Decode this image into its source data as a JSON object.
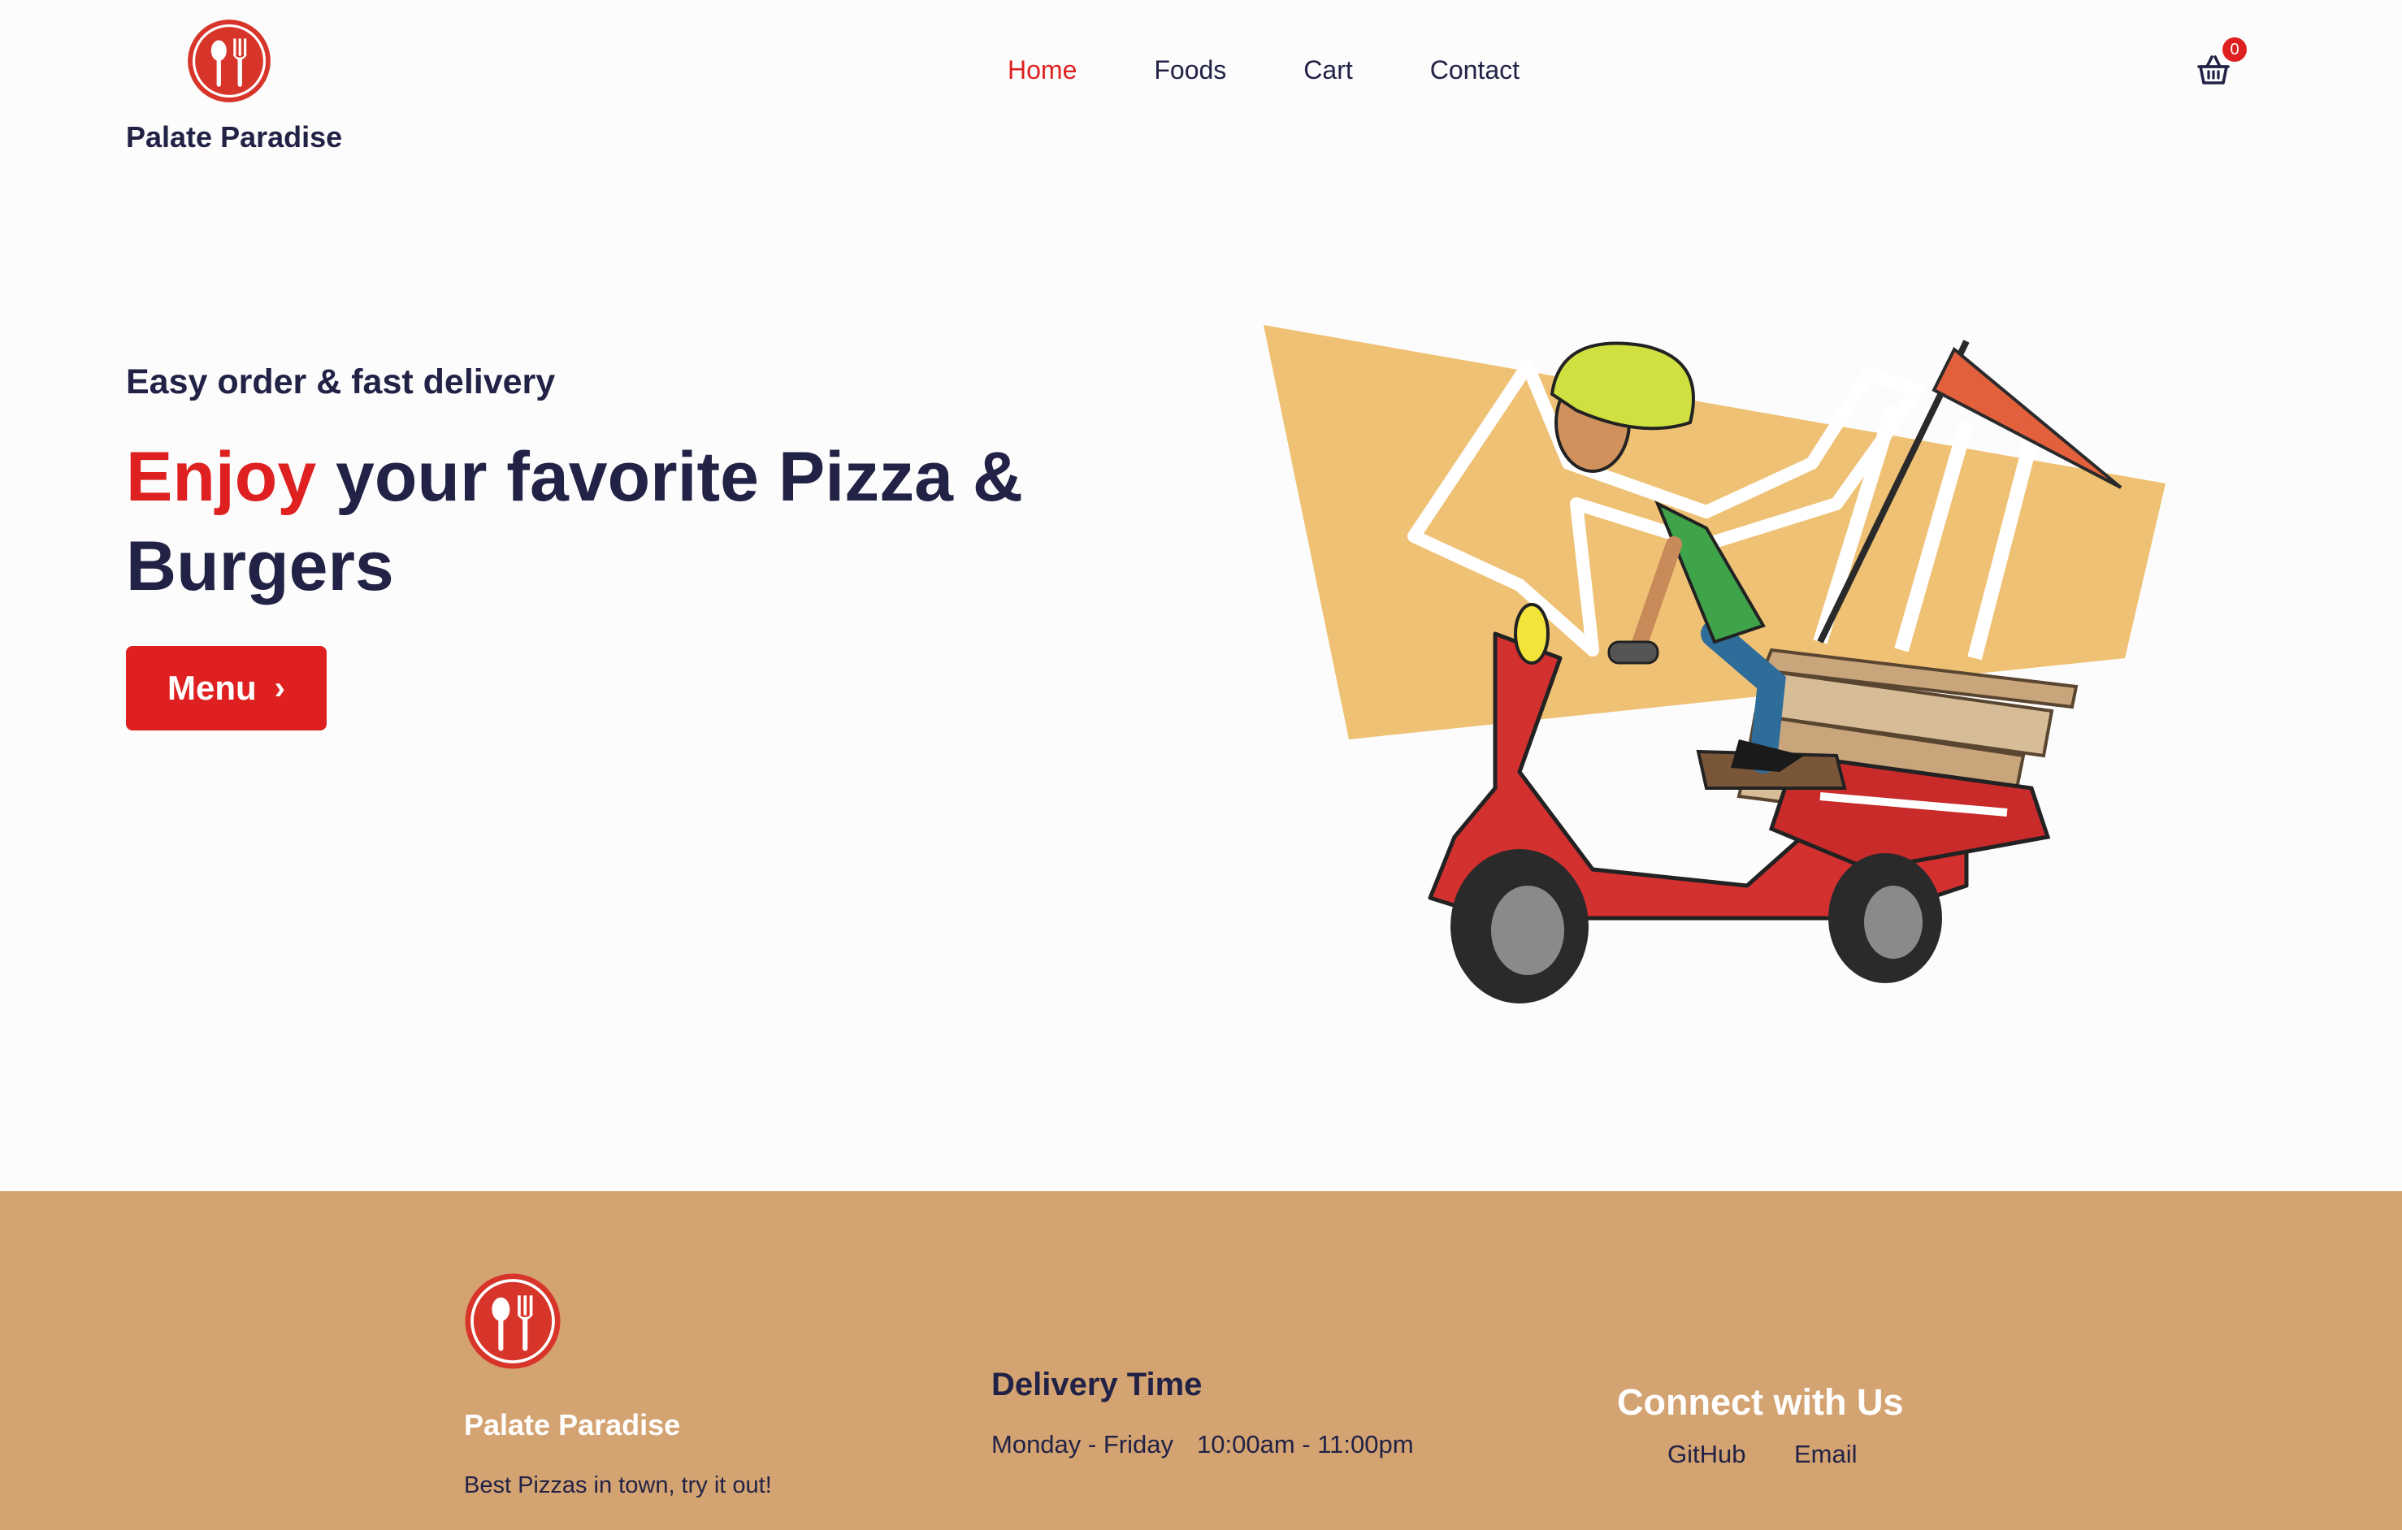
{
  "header": {
    "brand": "Palate Paradise",
    "nav": [
      {
        "label": "Home",
        "active": true
      },
      {
        "label": "Foods",
        "active": false
      },
      {
        "label": "Cart",
        "active": false
      },
      {
        "label": "Contact",
        "active": false
      }
    ],
    "cart_icon": "basket-icon",
    "cart_count": "0"
  },
  "hero": {
    "subtitle": "Easy order & fast delivery",
    "title_accent": "Enjoy",
    "title_rest": " your favorite Pizza & Burgers",
    "button_label": "Menu",
    "button_icon": "chevron-right-icon",
    "illustration": "pizza-delivery-scooter-illustration"
  },
  "footer": {
    "brand": "Palate Paradise",
    "tagline": "Best Pizzas in town, try it out!",
    "delivery": {
      "title": "Delivery Time",
      "days": "Monday - Friday",
      "hours": "10:00am - 11:00pm"
    },
    "connect": {
      "title": "Connect with Us",
      "links": [
        "GitHub",
        "Email"
      ]
    }
  },
  "colors": {
    "accent": "#df2020",
    "text": "#212245",
    "footer_bg": "#d4a372",
    "background": "#fcfcfc"
  }
}
